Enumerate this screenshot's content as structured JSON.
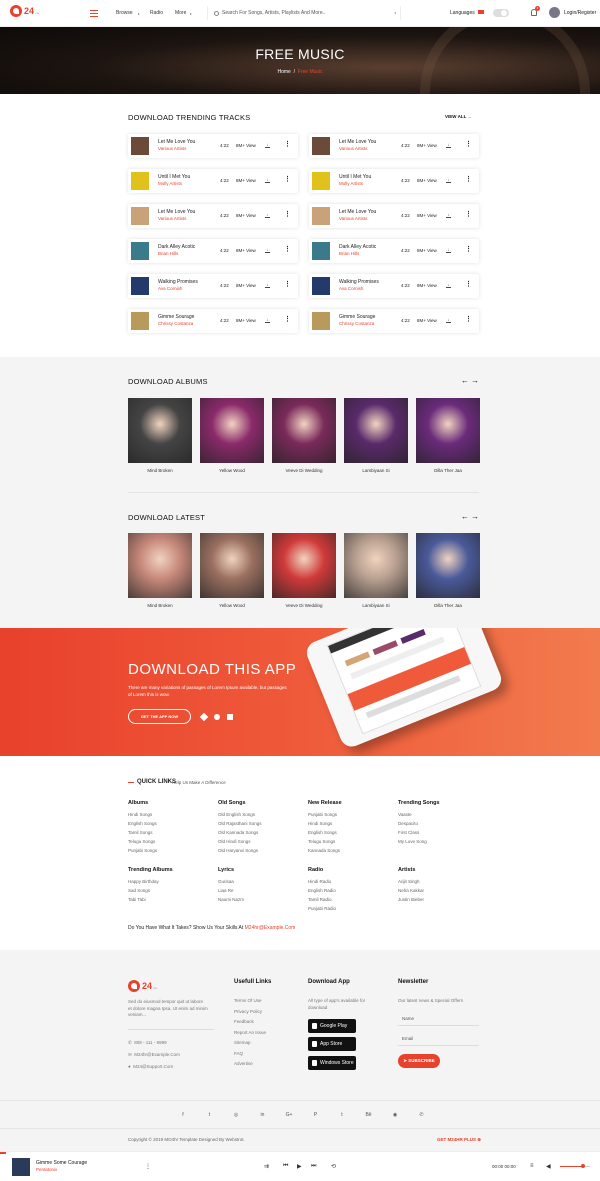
{
  "header": {
    "brand": "24",
    "brand_sub": "ms",
    "nav": [
      "Browse",
      "Radio",
      "More"
    ],
    "search_placeholder": "Search For Songs, Artists, Playlists And More..",
    "languages": "Languages",
    "notif_count": "2",
    "login": "Login/Register"
  },
  "hero": {
    "title": "FREE MUSIC",
    "crumb_home": "Home",
    "crumb_sep": "/",
    "crumb_current": "Free Music"
  },
  "trending": {
    "title": "DOWNLOAD TRENDING TRACKS",
    "view_all": "VIEW ALL",
    "tracks": [
      {
        "title": "Let Me Love You",
        "artist": "Various Artists",
        "duration": "4:22",
        "views": "8M+ View",
        "color": "#6b4a3a"
      },
      {
        "title": "Until I Met You",
        "artist": "Molly Artists",
        "duration": "4:22",
        "views": "8M+ View",
        "color": "#e0c21a"
      },
      {
        "title": "Let Me Love You",
        "artist": "Various Artists",
        "duration": "4:22",
        "views": "8M+ View",
        "color": "#c9a27a"
      },
      {
        "title": "Dark Alley Acotic",
        "artist": "Brian Hills",
        "duration": "4:22",
        "views": "8M+ View",
        "color": "#3a7a8a"
      },
      {
        "title": "Walking Promises",
        "artist": "Ava Cornish",
        "duration": "4:22",
        "views": "8M+ View",
        "color": "#243a6a"
      },
      {
        "title": "Gimme Sourage",
        "artist": "Chrissy Costanza",
        "duration": "4:22",
        "views": "8M+ View",
        "color": "#b89a5a"
      },
      {
        "title": "Let Me Love You",
        "artist": "Various Artists",
        "duration": "4:22",
        "views": "8M+ View",
        "color": "#6b4a3a"
      },
      {
        "title": "Until I Met You",
        "artist": "Molly Artists",
        "duration": "4:22",
        "views": "8M+ View",
        "color": "#e0c21a"
      },
      {
        "title": "Let Me Love You",
        "artist": "Various Artists",
        "duration": "4:22",
        "views": "8M+ View",
        "color": "#c9a27a"
      },
      {
        "title": "Dark Alley Acotic",
        "artist": "Brian Hills",
        "duration": "4:22",
        "views": "8M+ View",
        "color": "#3a7a8a"
      },
      {
        "title": "Walking Promises",
        "artist": "Ava Cornish",
        "duration": "4:22",
        "views": "8M+ View",
        "color": "#243a6a"
      },
      {
        "title": "Gimme Sourage",
        "artist": "Chrissy Costanza",
        "duration": "4:22",
        "views": "8M+ View",
        "color": "#b89a5a"
      }
    ]
  },
  "albums": {
    "title": "DOWNLOAD ALBUMS",
    "prev": "←",
    "next": "→",
    "items": [
      {
        "label": "Mind Broken",
        "color": "#444"
      },
      {
        "label": "Yellow Wood",
        "color": "#8a2a6a"
      },
      {
        "label": "Veeve Di Wedding",
        "color": "#7a2a5a"
      },
      {
        "label": "Lambiyaan Si",
        "color": "#5a2a6a"
      },
      {
        "label": "Dilla Ther Jaa",
        "color": "#6a2a7a"
      }
    ]
  },
  "latest": {
    "title": "DOWNLOAD LATEST",
    "prev": "←",
    "next": "→",
    "items": [
      {
        "label": "Mind Broken",
        "color": "#c7887a"
      },
      {
        "label": "Yellow Wood",
        "color": "#9a7060"
      },
      {
        "label": "Veeve Di Wedding",
        "color": "#d03a3a"
      },
      {
        "label": "Lambiyaan Si",
        "color": "#b8a090"
      },
      {
        "label": "Dilla Ther Jaa",
        "color": "#4a5a9a"
      }
    ]
  },
  "app": {
    "title": "DOWNLOAD THIS APP",
    "text": "There are many variations of passages of Lorem Ipsum available, but passages of Lorem this is wow.",
    "button": "GET THE APP NOW"
  },
  "quick": {
    "title": "QUICK LINKS",
    "subtitle": "Help Us Make A Difference",
    "cols": [
      {
        "head": "Albums",
        "items": [
          "Hindi Songs",
          "English Songs",
          "Tamil Songs",
          "Telugu Songs",
          "Punjabi Songs"
        ]
      },
      {
        "head": "Old Songs",
        "items": [
          "Old English Songs",
          "Old Rajasthani Songs",
          "Old Kannada Songs",
          "Old Hindi Songs",
          "Old Haryanvi Songs"
        ]
      },
      {
        "head": "New Release",
        "items": [
          "Punjabi Songs",
          "Hindi Songs",
          "English Songs",
          "Telugu Songs",
          "Kannada Songs"
        ]
      },
      {
        "head": "Trending Songs",
        "items": [
          "Vaaste",
          "Despacito",
          "First Class",
          "My Love Song"
        ]
      },
      {
        "head": "Trending Albums",
        "items": [
          "Happy Birthday",
          "Sad Songs",
          "Tabi Tabi"
        ]
      },
      {
        "head": "Lyrics",
        "items": [
          "Gurisaa",
          "Liaa Re",
          "Naumi Nazm"
        ]
      },
      {
        "head": "Radio",
        "items": [
          "Hindi Radio",
          "English Radio",
          "Tamil Radio",
          "Punjabi Radio"
        ]
      },
      {
        "head": "Artists",
        "items": [
          "Arijit Singh",
          "Neha Kakkar",
          "Justin Bieber"
        ]
      }
    ],
    "talent": "Do You Have What It Takes? Show Us Your Skills At",
    "talent_email": "M24hr@Example.Com"
  },
  "footer": {
    "brand": "24",
    "brand_sub": "ms",
    "about": "Sed do eiusmod tempor quit ut labore et dolore magna Ipsa. Ut enim ad minim veniam...",
    "phone": "808 - 111 - 9999",
    "email1": "M24hr@Example.Com",
    "email2": "M24@Support.Com",
    "useful_title": "Usefull Links",
    "useful": [
      "Terms Of Use",
      "Privacy Policy",
      "Feedback",
      "Report An Issue",
      "Sitemap",
      "FAQ",
      "Advertise"
    ],
    "download_title": "Download App",
    "download_text": "All type of app's available for download",
    "stores": [
      "Google Play",
      "App Store",
      "Windows Store"
    ],
    "news_title": "Newsletter",
    "news_text": "Our latest news & Special Offers",
    "name_ph": "Name",
    "email_ph": "Email",
    "subscribe": "SUBSCRIBE",
    "social": [
      "f",
      "t",
      "◎",
      "in",
      "G+",
      "P",
      "t",
      "Bē",
      "◉",
      "✆"
    ],
    "copyright": "Copyright © 2019 MO4hr Template Designed By Webstrot.",
    "plus": "GET M24HR PLUS"
  },
  "player": {
    "title": "Gimme Some Courage",
    "artist": "Pentatonix",
    "time": "00:00 00:00",
    "progress": 0.01,
    "volume": 0.75
  }
}
